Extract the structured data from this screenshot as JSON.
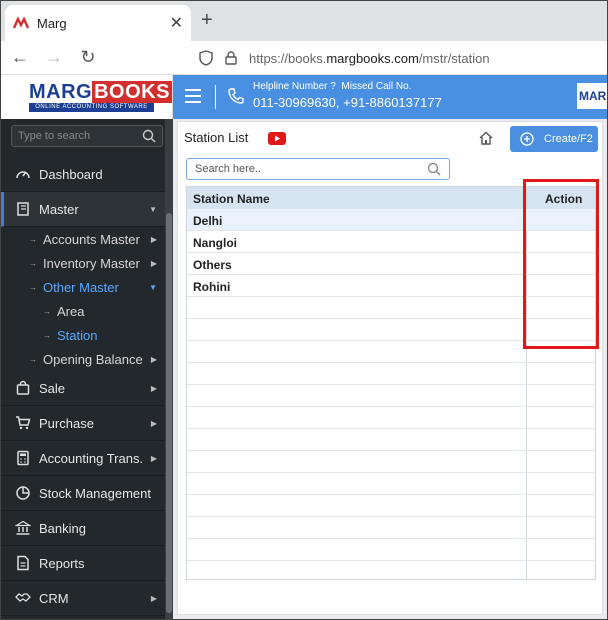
{
  "browser": {
    "tab_title": "Marg",
    "new_tab": "+",
    "url_prefix": "https://books.",
    "url_host": "margbooks.com",
    "url_path": "/mstr/station"
  },
  "header": {
    "logo_marg": "MARG",
    "logo_books": "BOOKS",
    "logo_sub": "ONLINE ACCOUNTING SOFTWARE",
    "helpline_label": "Helpline Number ?",
    "missed_call_label": "Missed Call No.",
    "helpline_numbers": "011-30969630, +91-8860137177",
    "right_logo": "MAR"
  },
  "sidebar": {
    "search_placeholder": "Type to search",
    "items": {
      "dashboard": "Dashboard",
      "master": "Master",
      "accounts_master": "Accounts Master",
      "inventory_master": "Inventory Master",
      "other_master": "Other Master",
      "area": "Area",
      "station": "Station",
      "opening_balance": "Opening Balance",
      "sale": "Sale",
      "purchase": "Purchase",
      "accounting_trans": "Accounting Trans.",
      "stock_management": "Stock Management",
      "banking": "Banking",
      "reports": "Reports",
      "crm": "CRM"
    }
  },
  "main": {
    "title": "Station List",
    "create_label": "Create/F2",
    "search_placeholder": "Search here..",
    "columns": {
      "name": "Station Name",
      "action": "Action"
    },
    "rows": [
      "Delhi",
      "Nangloi",
      "Others",
      "Rohini"
    ]
  },
  "colors": {
    "accent": "#4a90e2",
    "sidebar_bg": "#23282d",
    "highlight": "#e01818"
  }
}
